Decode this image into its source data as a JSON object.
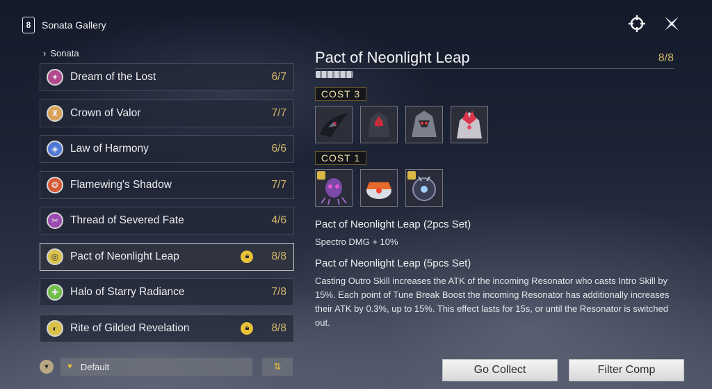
{
  "header": {
    "title": "Sonata Gallery"
  },
  "breadcrumb": {
    "label": "Sonata"
  },
  "sets": [
    {
      "name": "Dream of the Lost",
      "count": "6/7",
      "icon": "star-crest-icon",
      "color": "#b14a8c",
      "locked": false
    },
    {
      "name": "Crown of Valor",
      "count": "7/7",
      "icon": "crown-shield-icon",
      "color": "#d9a253",
      "locked": false
    },
    {
      "name": "Law of Harmony",
      "count": "6/6",
      "icon": "harmony-icon",
      "color": "#4f77d6",
      "locked": false
    },
    {
      "name": "Flamewing's Shadow",
      "count": "7/7",
      "icon": "flame-wing-icon",
      "color": "#d65a34",
      "locked": false
    },
    {
      "name": "Thread of Severed Fate",
      "count": "4/6",
      "icon": "scissors-icon",
      "color": "#9b4ab0",
      "locked": false
    },
    {
      "name": "Pact of Neonlight Leap",
      "count": "8/8",
      "icon": "pact-shield-icon",
      "color": "#d9c14a",
      "locked": true
    },
    {
      "name": "Halo of Starry Radiance",
      "count": "7/8",
      "icon": "halo-shield-icon",
      "color": "#6fbf4a",
      "locked": false
    },
    {
      "name": "Rite of Gilded Revelation",
      "count": "8/8",
      "icon": "gilded-ring-icon",
      "color": "#d9c14a",
      "locked": true
    }
  ],
  "filter": {
    "selected": "Default"
  },
  "detail": {
    "title": "Pact of Neonlight Leap",
    "count": "8/8",
    "cost3_label": "COST  3",
    "cost1_label": "COST  1",
    "cost3_echoes": [
      "echo-raven-icon",
      "echo-red-mech-icon",
      "echo-silver-mech-icon",
      "echo-crystal-beast-icon"
    ],
    "cost1_echoes": [
      "echo-purple-bug-icon",
      "echo-orange-drone-icon",
      "echo-dark-orb-icon"
    ],
    "set2_header": "Pact of Neonlight Leap (2pcs Set)",
    "set2_text": "Spectro DMG + 10%",
    "set5_header": "Pact of Neonlight Leap (5pcs Set)",
    "set5_text": "Casting Outro Skill increases the ATK of the incoming Resonator who casts Intro Skill by 15%. Each point of Tune Break Boost the incoming Resonator has additionally increases their ATK by 0.3%, up to 15%. This effect lasts for 15s, or until the Resonator is switched out."
  },
  "actions": {
    "go_collect": "Go Collect",
    "filter_comp": "Filter Comp"
  },
  "colors": {
    "accent_gold": "#d7b96a",
    "lock_yellow": "#e9c23a"
  }
}
